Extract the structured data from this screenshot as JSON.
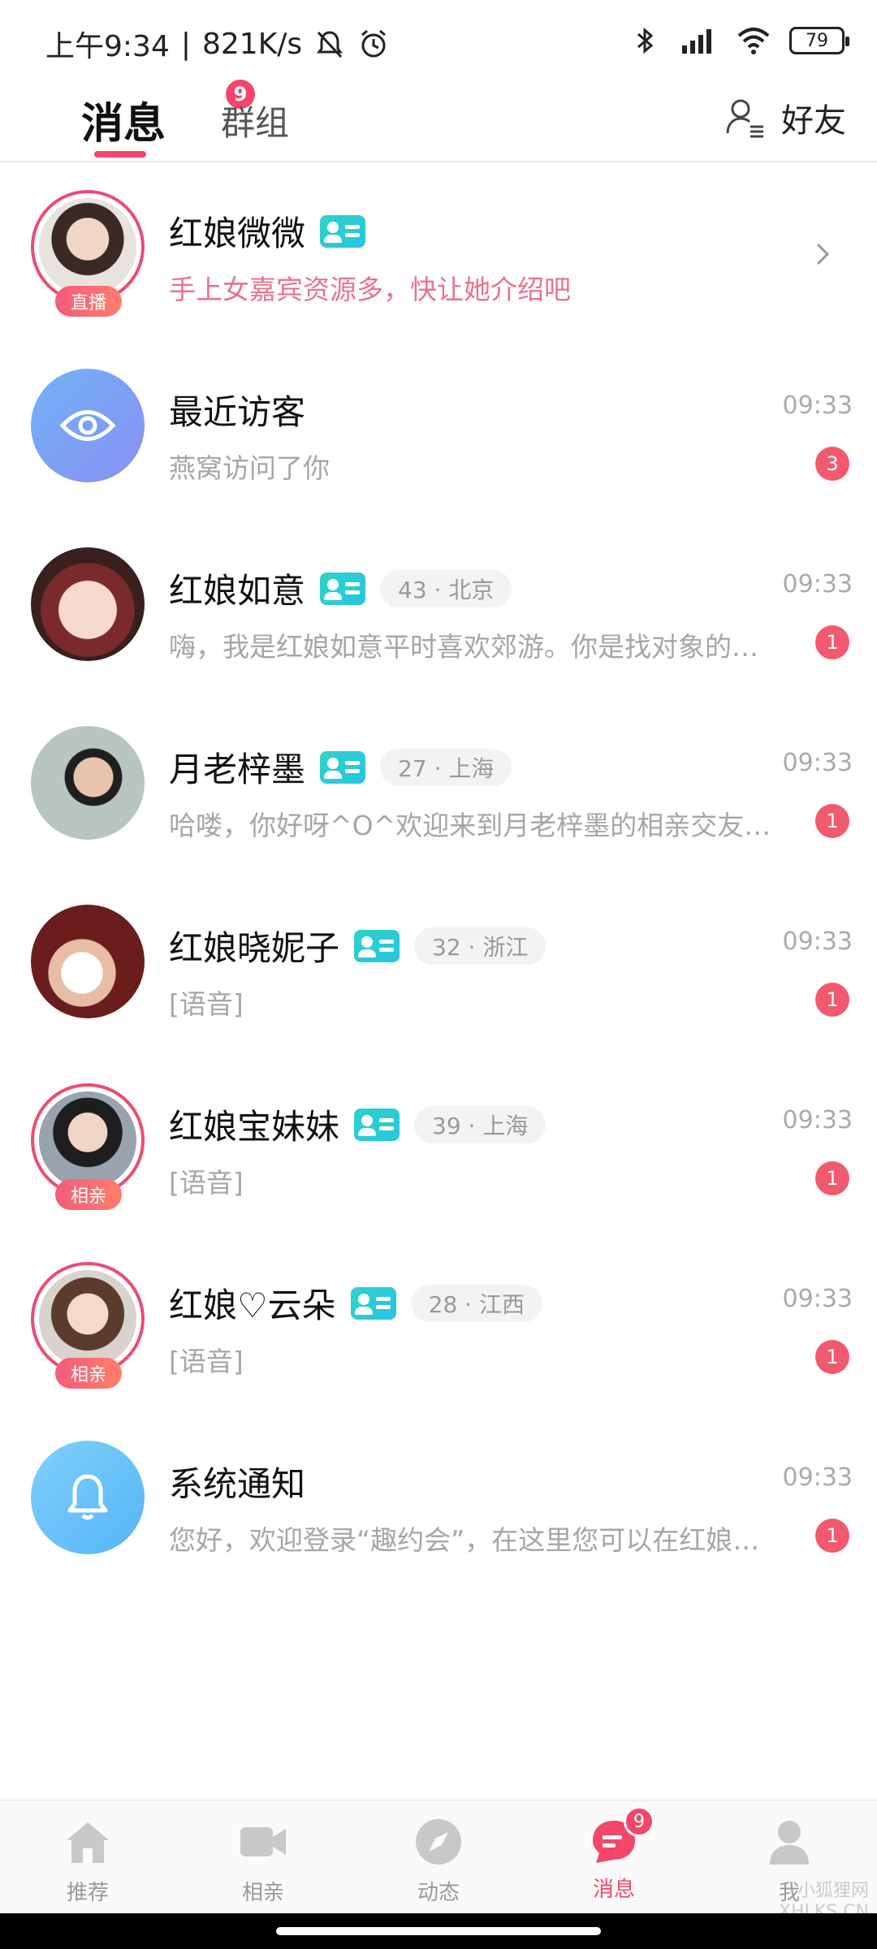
{
  "status_bar": {
    "time": "上午9:34",
    "speed": "821K/s",
    "icons": [
      "mute-bell-icon",
      "alarm-icon",
      "bluetooth-icon",
      "signal-icon",
      "wifi-icon"
    ],
    "battery": "79"
  },
  "header": {
    "tab_messages": "消息",
    "tab_messages_badge": "9",
    "tab_groups": "群组",
    "friends_label": "好友"
  },
  "chats": [
    {
      "name": "红娘微微",
      "tag": "直播",
      "preview": "手上女嘉宾资源多，快让她介绍吧"
    },
    {
      "name": "最近访客",
      "time": "09:33",
      "preview": "燕窝访问了你",
      "unread": "3"
    },
    {
      "name": "红娘如意",
      "age_loc": "43 · 北京",
      "time": "09:33",
      "preview": "嗨，我是红娘如意平时喜欢郊游。你是找对象的吗？",
      "unread": "1"
    },
    {
      "name": "月老梓墨",
      "age_loc": "27 · 上海",
      "time": "09:33",
      "preview": "哈喽，你好呀^O^欢迎来到月老梓墨的相亲交友房间",
      "unread": "1"
    },
    {
      "name": "红娘晓妮子",
      "age_loc": "32 · 浙江",
      "time": "09:33",
      "preview": "[语音]",
      "unread": "1"
    },
    {
      "name": "红娘宝妹妹",
      "age_loc": "39 · 上海",
      "time": "09:33",
      "preview": "[语音]",
      "unread": "1",
      "tag": "相亲"
    },
    {
      "name": "红娘♡云朵",
      "age_loc": "28 · 江西",
      "time": "09:33",
      "preview": "[语音]",
      "unread": "1",
      "tag": "相亲"
    },
    {
      "name": "系统通知",
      "time": "09:33",
      "preview": "您好，欢迎登录“趣约会”，在这里您可以在红娘的帮助下",
      "unread": "1"
    }
  ],
  "bottom_nav": {
    "items": [
      {
        "label": "推荐",
        "icon": "home-icon"
      },
      {
        "label": "相亲",
        "icon": "video-camera-icon"
      },
      {
        "label": "动态",
        "icon": "compass-icon"
      },
      {
        "label": "消息",
        "icon": "message-icon",
        "badge": "9",
        "active": true
      },
      {
        "label": "我",
        "icon": "person-icon"
      }
    ]
  },
  "watermark": {
    "line1": "小狐狸网",
    "line2": "XHLKS.CN"
  },
  "colors": {
    "accent": "#f2466b",
    "teal": "#2ed3c9",
    "unread": "#f15a6e"
  }
}
